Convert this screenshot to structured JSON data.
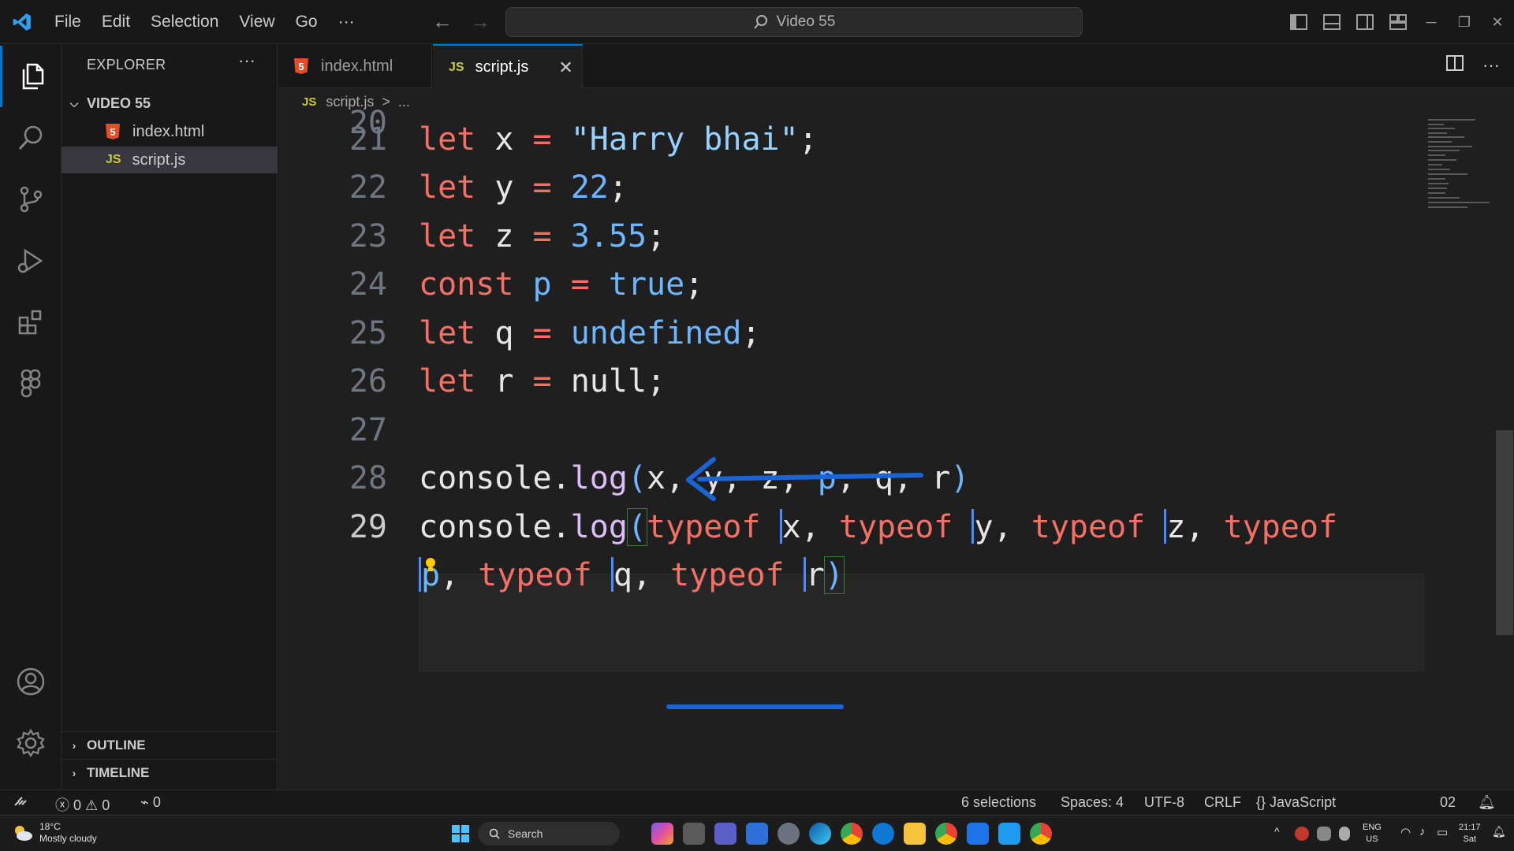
{
  "titlebar": {
    "menu": [
      "File",
      "Edit",
      "Selection",
      "View",
      "Go",
      "···"
    ],
    "search_text": "Video 55"
  },
  "sidebar": {
    "title": "EXPLORER",
    "folder": "VIDEO 55",
    "files": [
      {
        "name": "index.html",
        "type": "html"
      },
      {
        "name": "script.js",
        "type": "js",
        "selected": true
      }
    ],
    "sections": [
      "OUTLINE",
      "TIMELINE"
    ]
  },
  "tabs": [
    {
      "label": "index.html",
      "type": "html",
      "active": false
    },
    {
      "label": "script.js",
      "type": "js",
      "active": true
    }
  ],
  "breadcrumb": {
    "js": "JS",
    "file": "script.js",
    "sep": ">",
    "rest": "..."
  },
  "editor": {
    "partial_line_number": "20",
    "line_numbers": [
      "21",
      "22",
      "23",
      "24",
      "25",
      "26",
      "27",
      "28",
      "29"
    ]
  },
  "statusbar": {
    "errors": "0",
    "warnings": "0",
    "ports": "0",
    "selections": "6 selections",
    "spaces": "Spaces: 4",
    "encoding": "UTF-8",
    "eol": "CRLF",
    "language": "JavaScript",
    "right_partial": "02"
  },
  "taskbar": {
    "temperature": "18°C",
    "weather": "Mostly cloudy",
    "search": "Search",
    "lang_top": "ENG",
    "lang_bottom": "US",
    "time": "21:17",
    "day": "Sat"
  },
  "colors": {
    "accent": "#0078d4",
    "keyword": "#f47067",
    "string": "#96d0ff",
    "number": "#6cb6ff",
    "function": "#dcbdfb",
    "annotation": "#1b64d8"
  }
}
